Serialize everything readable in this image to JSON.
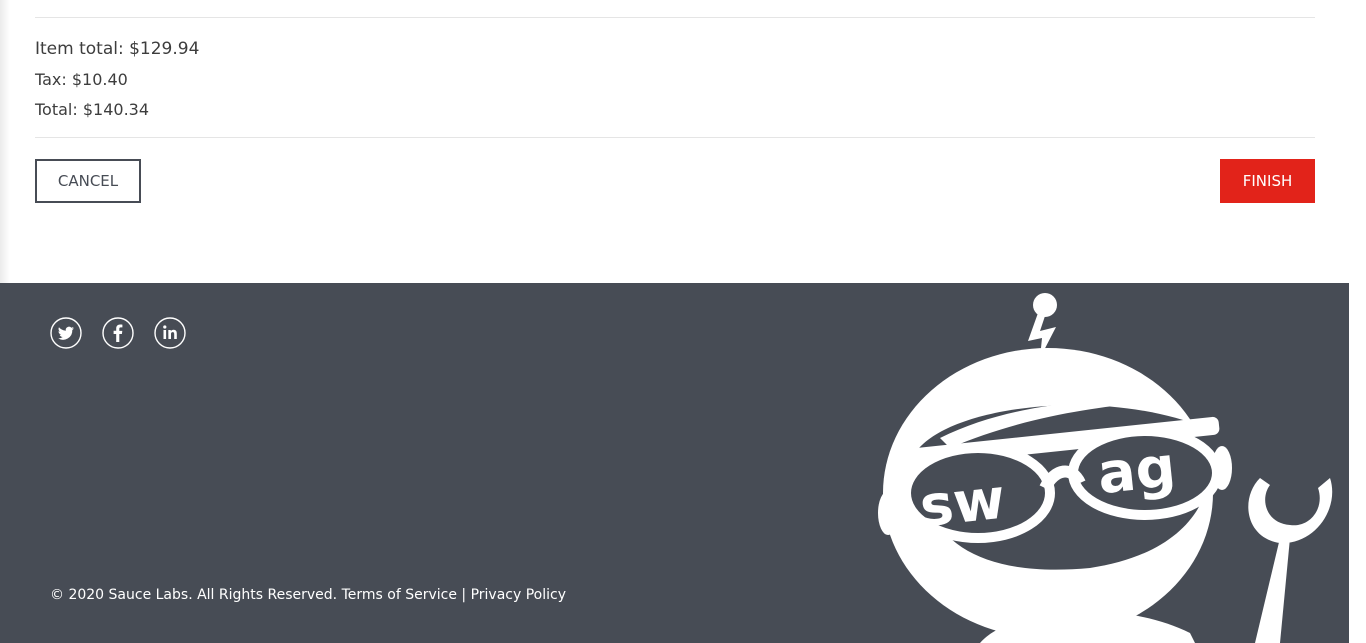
{
  "summary": {
    "item_total": "Item total: $129.94",
    "tax": "Tax: $10.40",
    "total": "Total: $140.34"
  },
  "buttons": {
    "cancel": "CANCEL",
    "finish": "FINISH"
  },
  "footer": {
    "social": [
      "twitter-icon",
      "facebook-icon",
      "linkedin-icon"
    ],
    "copyright": "© 2020 Sauce Labs. All Rights Reserved.",
    "terms": "Terms of Service",
    "separator": "|",
    "privacy": "Privacy Policy",
    "mascot_text": "swag"
  },
  "colors": {
    "accent": "#e2231a",
    "footer_bg": "#474c55",
    "text": "#484c55"
  }
}
